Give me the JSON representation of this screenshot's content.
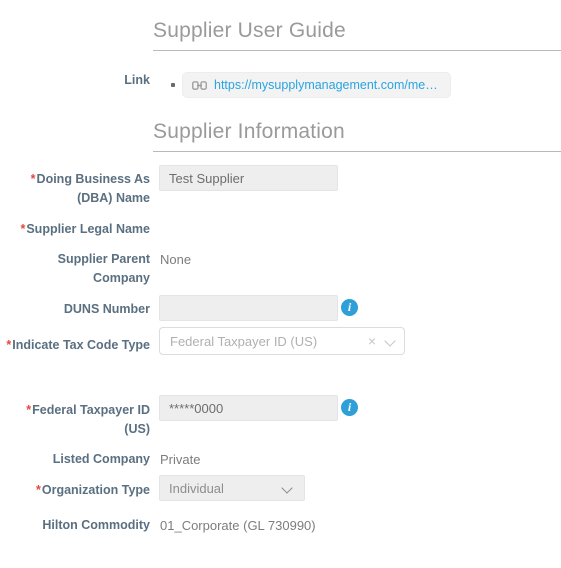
{
  "sections": {
    "user_guide": {
      "heading": "Supplier User Guide",
      "link_label": "Link",
      "link": {
        "icon": "link-icon",
        "text": "https://mysupplymanagement.com/media…"
      }
    },
    "supplier_information": {
      "heading": "Supplier Information"
    }
  },
  "fields": {
    "dba_name": {
      "label": "Doing Business As (DBA) Name",
      "required": true,
      "value": "Test Supplier"
    },
    "supplier_legal_name": {
      "label": "Supplier Legal Name",
      "required": true,
      "value": ""
    },
    "supplier_parent_company": {
      "label": "Supplier Parent Company",
      "required": false,
      "value": "None"
    },
    "duns_number": {
      "label": "DUNS Number",
      "required": false,
      "value": "",
      "info_icon": "info-icon"
    },
    "indicate_tax_code_type": {
      "label": "Indicate Tax Code Type",
      "required": true,
      "value": "Federal Taxpayer ID (US)",
      "clear_icon": "×",
      "chevron_icon": "chevron-down-icon"
    },
    "federal_taxpayer_id": {
      "label": "Federal Taxpayer ID (US)",
      "required": true,
      "value": "*****0000",
      "info_icon": "info-icon"
    },
    "listed_company": {
      "label": "Listed Company",
      "required": false,
      "value": "Private"
    },
    "organization_type": {
      "label": "Organization Type",
      "required": true,
      "value": "Individual",
      "chevron_icon": "chevron-down-icon"
    },
    "hilton_commodity": {
      "label": "Hilton Commodity",
      "required": false,
      "value": "01_Corporate (GL 730990)"
    }
  },
  "colors": {
    "label": "#5a6f80",
    "required_asterisk": "#e8453c",
    "heading": "#9a9a9a",
    "link": "#2aa4e0",
    "info_badge": "#2f9fd8",
    "input_background": "#eeeeee"
  },
  "icons": {
    "info": "i"
  }
}
